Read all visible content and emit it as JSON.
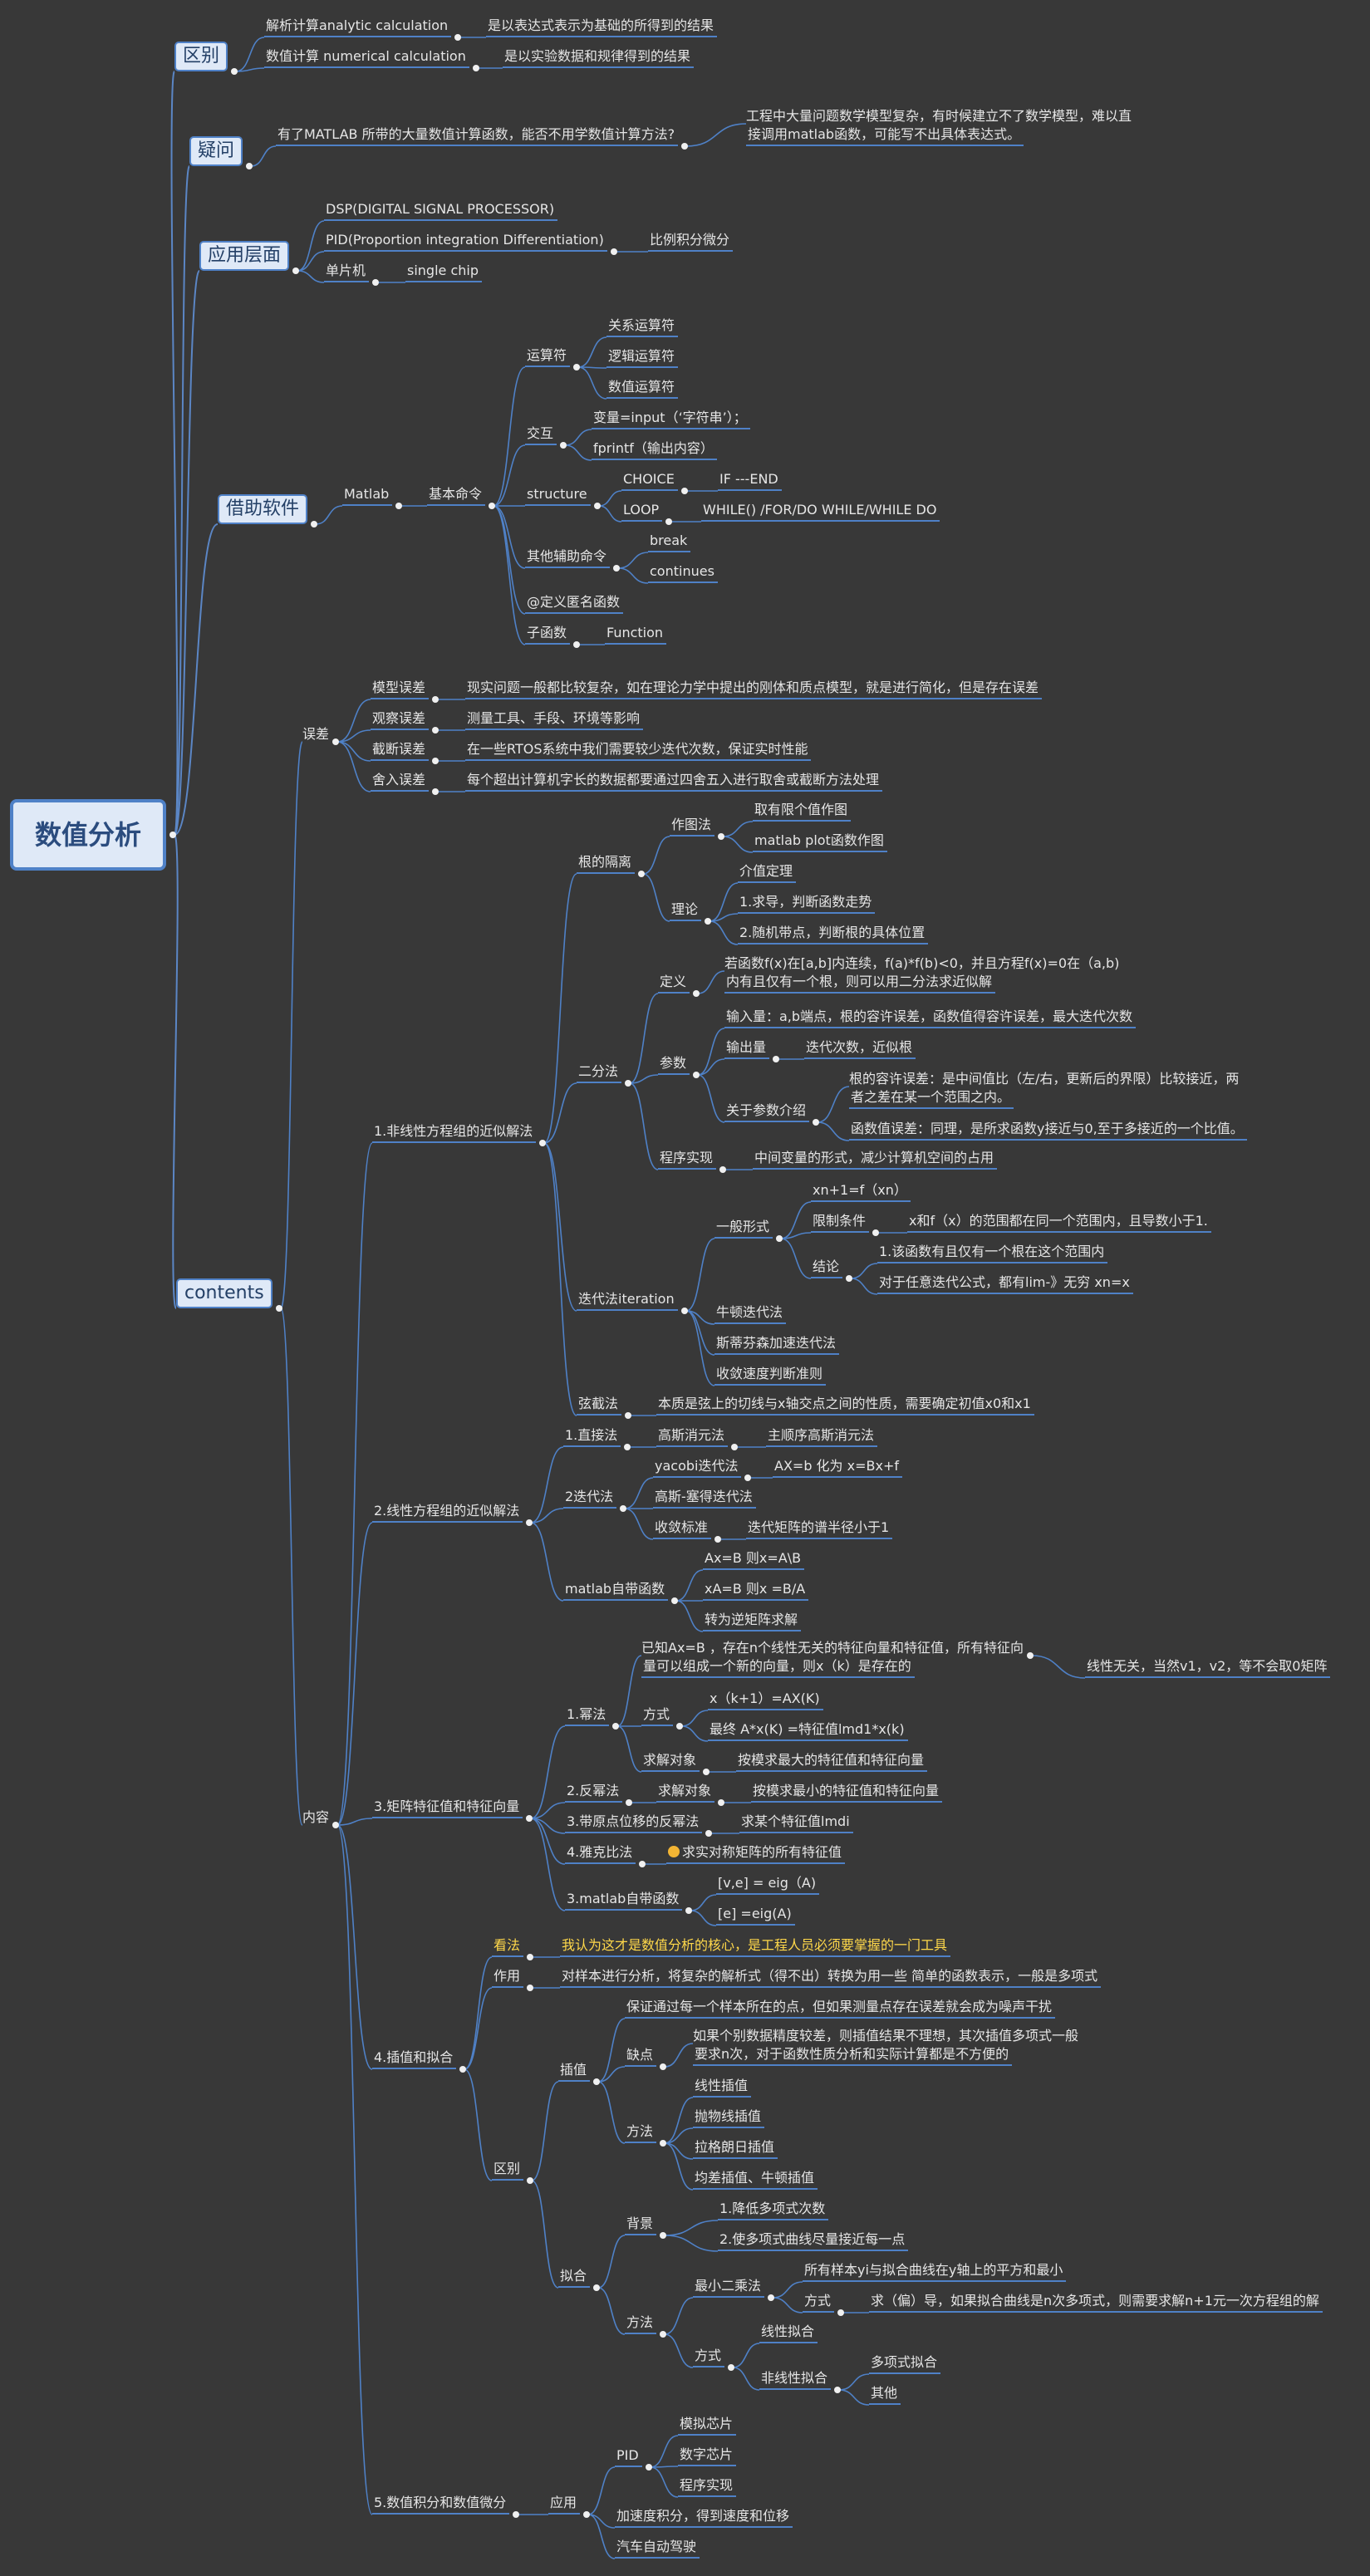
{
  "root": "数值分析",
  "区别": {
    "label": "区别",
    "analytic": "解析计算analytic calculation",
    "analytic_desc": "是以表达式表示为基础的所得到的结果",
    "numerical": "数值计算 numerical calculation",
    "numerical_desc": "是以实验数据和规律得到的结果"
  },
  "疑问": {
    "label": "疑问",
    "question": "有了MATLAB 所带的大量数值计算函数，能否不用学数值计算方法?",
    "answer_1": "工程中大量问题数学模型复杂，有时候建立不了数学模型，难以直",
    "answer_2": "接调用matlab函数，可能写不出具体表达式。"
  },
  "应用层面": {
    "label": "应用层面",
    "dsp": "DSP(DIGITAL SIGNAL PROCESSOR)",
    "pid": "PID(Proportion integration Differentiation)",
    "pid_cn": "比例积分微分",
    "mcu": "单片机",
    "mcu_en": "single chip"
  },
  "借助软件": {
    "label": "借助软件",
    "matlab": "Matlab",
    "basic_cmd": "基本命令",
    "operators": "运算符",
    "op_relation": "关系运算符",
    "op_logic": "逻辑运算符",
    "op_numeric": "数值运算符",
    "interact": "交互",
    "input": "变量=input（‘字符串’）；",
    "fprintf": "fprintf（输出内容）",
    "structure": "structure",
    "choice": "CHOICE",
    "if": "IF ---END",
    "loop": "LOOP",
    "while": "WHILE() /FOR/DO WHILE/WHILE DO",
    "aux_cmd": "其他辅助命令",
    "break": "break",
    "continues": "continues",
    "define": "@定义匿名函数",
    "subfunc": "子函数",
    "function": "Function"
  },
  "contents": {
    "label": "contents",
    "误差": {
      "label": "误差",
      "model": "模型误差",
      "model_desc": "现实问题一般都比较复杂，如在理论力学中提出的刚体和质点模型，就是进行简化，但是存在误差",
      "observe": "观察误差",
      "observe_desc": "测量工具、手段、环境等影响",
      "truncate": "截断误差",
      "truncate_desc": "在一些RTOS系统中我们需要较少迭代次数，保证实时性能",
      "round": "舍入误差",
      "round_desc": "每个超出计算机字长的数据都要通过四舍五入进行取舍或截断方法处理"
    },
    "内容": {
      "label": "内容",
      "s1": {
        "label": "1.非线性方程组的近似解法",
        "root_sep": "根的隔离",
        "plot": "作图法",
        "plot_a": "取有限个值作图",
        "plot_b": "matlab plot函数作图",
        "theory": "理论",
        "theory_a": "介值定理",
        "theory_b": "1.求导，判断函数走势",
        "theory_c": "2.随机带点，判断根的具体位置",
        "bisect": "二分法",
        "def": "定义",
        "def_1": "若函数f(x)在[a,b]内连续，f(a)*f(b)<0，并且方程f(x)=0在（a,b)",
        "def_2": "内有且仅有一个根，则可以用二分法求近似解",
        "params": "参数",
        "input_q": "输入量：a,b端点，根的容许误差，函数值得容许误差，最大迭代次数",
        "output_q": "输出量",
        "output_desc": "迭代次数，近似根",
        "param_intro": "关于参数介绍",
        "tol_1": "根的容许误差：是中间值比（左/右，更新后的界限）比较接近，两",
        "tol_2": "者之差在某一个范围之内。",
        "ftol": "函数值误差：同理，是所求函数y接近与0,至于多接近的一个比值。",
        "impl": "程序实现",
        "impl_desc": "中间变量的形式，减少计算机空间的占用",
        "iter": "迭代法iteration",
        "general": "一般形式",
        "xn": "xn+1=f（xn）",
        "restrict": "限制条件",
        "restrict_desc": "x和f（x）的范围都在同一个范围内，且导数小于1.",
        "concl": "结论",
        "concl_a": "1.该函数有且仅有一个根在这个范围内",
        "concl_b": "对于任意迭代公式，都有lim-》无穷 xn=x",
        "newton": "牛顿迭代法",
        "steffensen": "斯蒂芬森加速迭代法",
        "converge": "收敛速度判断准则",
        "secant": "弦截法",
        "secant_desc": "本质是弦上的切线与x轴交点之间的性质，需要确定初值x0和x1"
      },
      "s2": {
        "label": "2.线性方程组的近似解法",
        "direct": "1.直接法",
        "gauss": "高斯消元法",
        "gauss_pivot": "主顺序高斯消元法",
        "iter": "2迭代法",
        "jacobi": "yacobi迭代法",
        "jacobi_desc": "AX=b 化为 x=Bx+f",
        "gs": "高斯-塞得迭代法",
        "conv": "收敛标准",
        "conv_desc": "迭代矩阵的谱半径小于1",
        "matlab": "matlab自带函数",
        "m1": "Ax=B 则x=A\\B",
        "m2": "xA=B 则x =B/A",
        "m3": "转为逆矩阵求解"
      },
      "s3": {
        "label": "3.矩阵特征值和特征向量",
        "power": "1.幂法",
        "known_1": "已知Ax=B ，存在n个线性无关的特征向量和特征值，所有特征向",
        "known_2": "量可以组成一个新的向量，则x（k）是存在的",
        "independent": "线性无关，当然v1，v2，等不会取0矩阵",
        "method": "方式",
        "method_a": "x（k+1）=AX(K)",
        "method_b": "最终 A*x(K) =特征值lmd1*x(k)",
        "target": "求解对象",
        "target_desc": "按模求最大的特征值和特征向量",
        "inverse": "2.反幂法",
        "inv_target": "求解对象",
        "inv_desc": "按模求最小的特征值和特征向量",
        "shifted": "3.带原点位移的反幂法",
        "shifted_desc": "求某个特征值lmdi",
        "jacobi": "4.雅克比法",
        "jacobi_desc": "求实对称矩阵的所有特征值",
        "matlab": "3.matlab自带函数",
        "eig_a": "[v,e] = eig（A)",
        "eig_b": "[e] =eig(A)"
      },
      "s4": {
        "label": "4.插值和拟合",
        "view": "看法",
        "view_desc": "我认为这才是数值分析的核心，是工程人员必须要掌握的一门工具",
        "use": "作用",
        "use_desc": "对样本进行分析，将复杂的解析式（得不出）转换为用一些 简单的函数表示，一般是多项式",
        "diff": "区别",
        "interp": "插值",
        "interp_keep": "保证通过每一个样本所在的点，但如果测量点存在误差就会成为噪声干扰",
        "defect": "缺点",
        "defect_1": "如果个别数据精度较差，则插值结果不理想，其次插值多项式一般",
        "defect_2": "要求n次，对于函数性质分析和实际计算都是不方便的",
        "ways": "方法",
        "linear": "线性插值",
        "parabola": "抛物线插值",
        "lagrange": "拉格朗日插值",
        "diffq": "均差插值、牛顿插值",
        "fit": "拟合",
        "bg": "背景",
        "bg_a": "1.降低多项式次数",
        "bg_b": "2.使多项式曲线尽量接近每一点",
        "fit_method": "方法",
        "lsq": "最小二乘法",
        "lsq_desc": "所有样本yi与拟合曲线在y轴上的平方和最小",
        "lsq_method": "方式",
        "lsq_method_desc": "求（偏）导，如果拟合曲线是n次多项式，则需要求解n+1元一次方程组的解",
        "fit_way": "方式",
        "linfit": "线性拟合",
        "nonlinfit": "非线性拟合",
        "polyfit": "多项式拟合",
        "other": "其他"
      },
      "s5": {
        "label": "5.数值积分和数值微分",
        "app": "应用",
        "pid": "PID",
        "analog": "模拟芯片",
        "digital": "数字芯片",
        "program": "程序实现",
        "accel": "加速度积分，得到速度和位移",
        "auto": "汽车自动驾驶"
      }
    }
  }
}
